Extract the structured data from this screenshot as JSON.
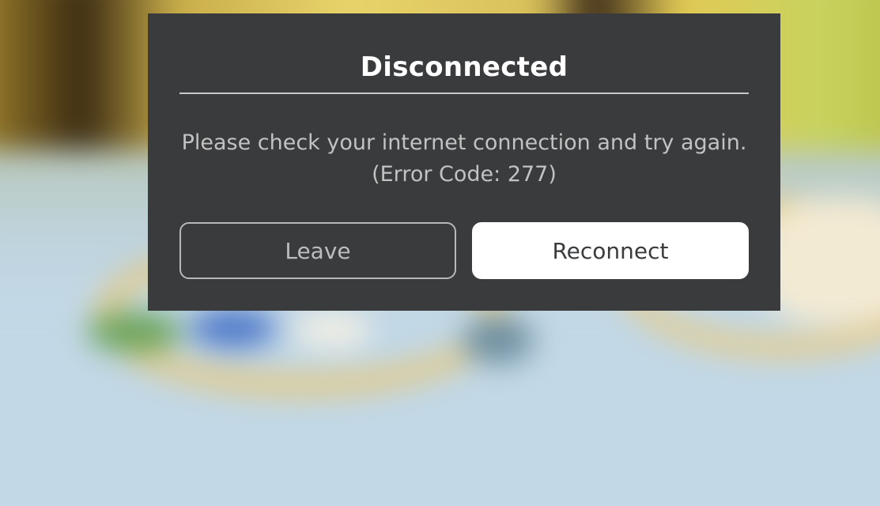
{
  "dialog": {
    "title": "Disconnected",
    "message_line1": "Please check your internet connection and try again.",
    "message_line2": "(Error Code: 277)",
    "leave_label": "Leave",
    "reconnect_label": "Reconnect"
  },
  "colors": {
    "dialog_background": "#393b3d",
    "title_text": "#ffffff",
    "message_text": "#c2c2c2",
    "primary_button_background": "#ffffff",
    "primary_button_text": "#393b3d",
    "secondary_button_border": "#b8b8b8"
  }
}
